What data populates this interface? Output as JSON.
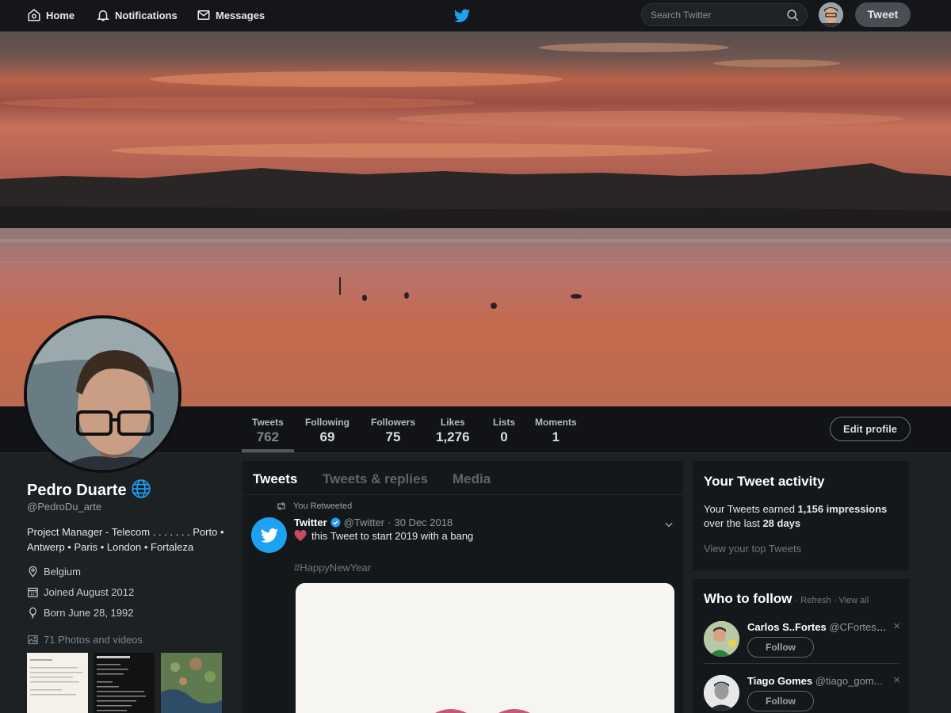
{
  "nav": {
    "home": "Home",
    "notifications": "Notifications",
    "messages": "Messages",
    "search_placeholder": "Search Twitter",
    "tweet_button": "Tweet",
    "logo_icon": "twitter-bird-icon"
  },
  "colors": {
    "brand": "#1da1f2",
    "background": "#1e2124",
    "panel": "#15181b",
    "nav": "#141619"
  },
  "stats": [
    {
      "label": "Tweets",
      "value": "762"
    },
    {
      "label": "Following",
      "value": "69"
    },
    {
      "label": "Followers",
      "value": "75"
    },
    {
      "label": "Likes",
      "value": "1,276"
    },
    {
      "label": "Lists",
      "value": "0"
    },
    {
      "label": "Moments",
      "value": "1"
    }
  ],
  "edit_profile": "Edit profile",
  "profile": {
    "name": "Pedro Duarte",
    "handle": "@PedroDu_arte",
    "bio": "Project Manager - Telecom . . . . . . . Porto • Antwerp • Paris • London • Fortaleza",
    "location": "Belgium",
    "joined": "Joined August 2012",
    "born": "Born June 28, 1992",
    "photos_link": "71 Photos and videos"
  },
  "timeline": {
    "tabs": [
      "Tweets",
      "Tweets & replies",
      "Media"
    ],
    "retweet_label": "You Retweeted",
    "tweet": {
      "author": "Twitter",
      "handle": "@Twitter",
      "date": "30 Dec 2018",
      "text": "this Tweet to start 2019 with a bang",
      "hashtag": "#HappyNewYear"
    }
  },
  "activity": {
    "title": "Your Tweet activity",
    "line1_prefix": "Your Tweets earned ",
    "impressions": "1,156 impressions",
    "line2_prefix": "over the last ",
    "period": "28 days",
    "link": "View your top Tweets"
  },
  "who_to_follow": {
    "title": "Who to follow",
    "refresh": "Refresh",
    "view_all": "View all",
    "separator": "·",
    "follow_label": "Follow",
    "users": [
      {
        "name": "Carlos S..Fortes",
        "handle": "@CFortes_..."
      },
      {
        "name": "Tiago Gomes",
        "handle": "@tiago_gom..."
      }
    ]
  }
}
